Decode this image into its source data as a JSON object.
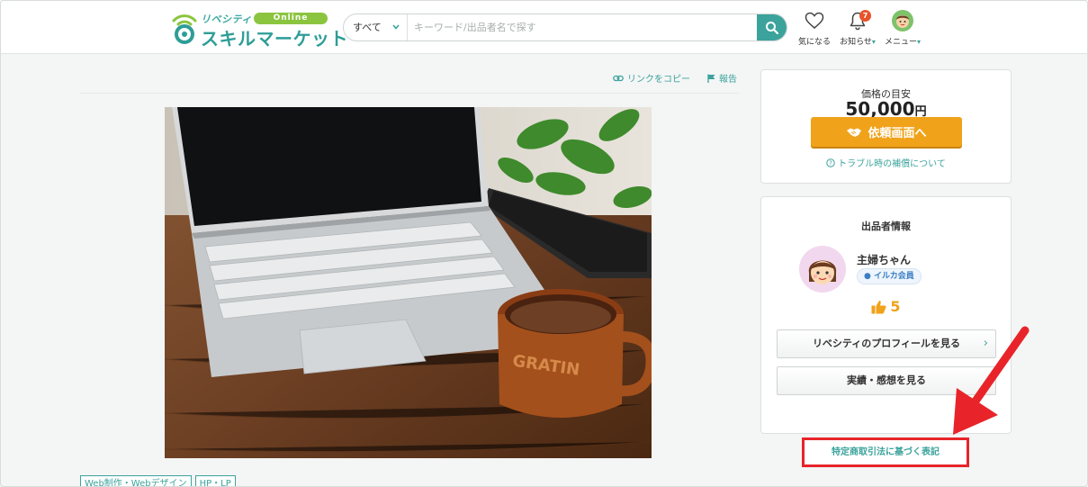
{
  "header": {
    "logo_top": "リベシティ",
    "logo_online": "Online",
    "logo_main": "スキルマーケット",
    "search_category": "すべて",
    "search_placeholder": "キーワード/出品者名で探す",
    "nav_favorite": "気になる",
    "nav_notifications": "お知らせ",
    "notification_count": "7",
    "nav_menu": "メニュー",
    "caret": "▾"
  },
  "main": {
    "copy_link": "リンクをコピー",
    "report": "報告",
    "tags": [
      "Web制作・Webデザイン",
      "HP・LP"
    ]
  },
  "price_card": {
    "label": "価格の目安",
    "amount": "50,000",
    "unit": "円",
    "order_button": "依頼画面へ",
    "trouble_link": "トラブル時の補償について"
  },
  "seller_card": {
    "title": "出品者情報",
    "name": "主婦ちゃん",
    "member_badge": "イルカ会員",
    "rating": "5",
    "profile_button": "リベシティのプロフィールを見る",
    "reviews_button": "実績・感想を見る",
    "chevron": "›"
  },
  "legal_link": "特定商取引法に基づく表記",
  "colors": {
    "accent": "#3ba39c",
    "order": "#f0a21a",
    "highlight": "#e8242a"
  }
}
